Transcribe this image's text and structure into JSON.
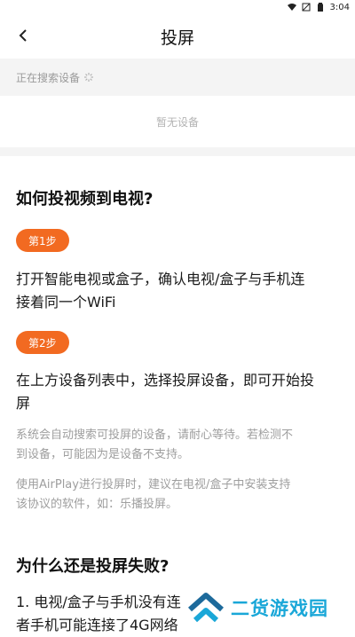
{
  "status": {
    "time": "3:04"
  },
  "header": {
    "title": "投屏"
  },
  "search": {
    "text": "正在搜索设备"
  },
  "devices": {
    "empty_text": "暂无设备"
  },
  "guide": {
    "heading": "如何投视频到电视?",
    "step1_label": "第1步",
    "step1_line1": "打开智能电视或盒子，确认电视/盒子与手机连",
    "step1_line2": "接着同一个WiFi",
    "step2_label": "第2步",
    "step2_line1": "在上方设备列表中，选择投屏设备，即可开始投",
    "step2_line2": "屏",
    "note1_line1": "系统会自动搜索可投屏的设备，请耐心等待。若检测不",
    "note1_line2": "到设备，可能因为是设备不支持。",
    "note2_line1": "使用AirPlay进行投屏时，建议在电视/盒子中安装支持",
    "note2_line2": "该协议的软件，如：乐播投屏。"
  },
  "failure": {
    "heading": "为什么还是投屏失败?",
    "item1_line1": "1. 电视/盒子与手机没有连",
    "item1_line2": "者手机可能连接了4G网络"
  },
  "watermark": {
    "text": "二货游戏园"
  },
  "colors": {
    "accent": "#f26a21",
    "watermark": "#1aa7d8"
  }
}
